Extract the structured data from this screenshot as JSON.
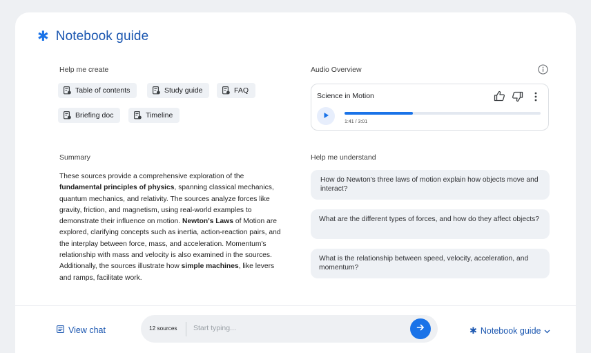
{
  "header": {
    "title": "Notebook guide",
    "icon": "sparkle-icon"
  },
  "help_create": {
    "label": "Help me create",
    "chips": [
      "Table of contents",
      "Study guide",
      "FAQ",
      "Briefing doc",
      "Timeline"
    ]
  },
  "audio_overview": {
    "label": "Audio Overview",
    "title": "Science in Motion",
    "time": "1:41 / 3:01",
    "progress": 0.35
  },
  "summary": {
    "label": "Summary",
    "parts": [
      "These sources provide a comprehensive exploration of the ",
      "fundamental principles of physics",
      ", spanning classical mechanics, quantum mechanics, and relativity. The sources analyze forces like gravity, friction, and magnetism, using real-world examples to demonstrate their influence on motion. ",
      "Newton's Laws",
      " of Motion are explored, clarifying concepts such as inertia, action-reaction pairs, and the interplay between force, mass, and acceleration. Momentum's relationship with mass and velocity is also examined in the sources. Additionally, the sources illustrate how ",
      "simple machines",
      ", like levers and ramps, facilitate work."
    ]
  },
  "help_understand": {
    "label": "Help me understand",
    "questions": [
      "How do Newton's three laws of motion explain how objects move and interact?",
      "What are the different types of forces, and how do they affect objects?",
      "What is the relationship between speed, velocity, acceleration, and momentum?"
    ]
  },
  "footer": {
    "view_chat": "View chat",
    "sources": "12 sources",
    "placeholder": "Start typing...",
    "notebook_guide": "Notebook guide"
  },
  "colors": {
    "accent": "#1a73e8",
    "title": "#1a56b0",
    "chip_bg": "#eef1f5"
  }
}
